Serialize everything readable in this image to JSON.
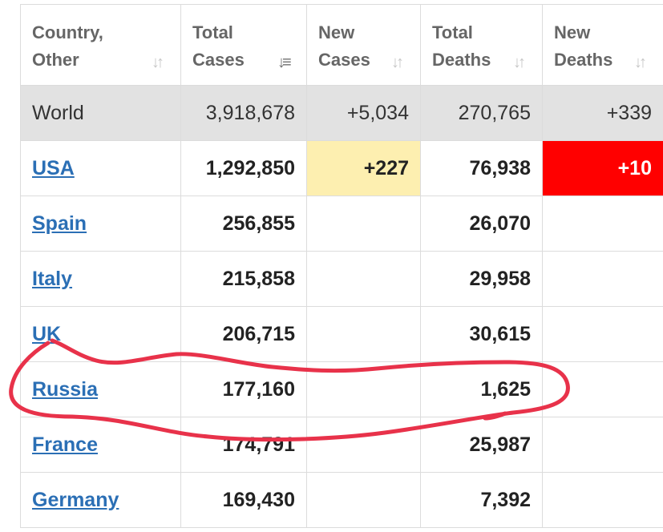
{
  "headers": [
    {
      "line1": "Country,",
      "line2": "Other",
      "icon": "sort-icon"
    },
    {
      "line1": "Total",
      "line2": "Cases",
      "icon": "sort-desc-icon"
    },
    {
      "line1": "New",
      "line2": "Cases",
      "icon": "sort-icon"
    },
    {
      "line1": "Total",
      "line2": "Deaths",
      "icon": "sort-icon"
    },
    {
      "line1": "New",
      "line2": "Deaths",
      "icon": "sort-icon"
    }
  ],
  "rows": [
    {
      "country": "World",
      "total_cases": "3,918,678",
      "new_cases": "+5,034",
      "total_deaths": "270,765",
      "new_deaths": "+339"
    },
    {
      "country": "USA",
      "total_cases": "1,292,850",
      "new_cases": "+227",
      "total_deaths": "76,938",
      "new_deaths": "+10"
    },
    {
      "country": "Spain",
      "total_cases": "256,855",
      "new_cases": "",
      "total_deaths": "26,070",
      "new_deaths": ""
    },
    {
      "country": "Italy",
      "total_cases": "215,858",
      "new_cases": "",
      "total_deaths": "29,958",
      "new_deaths": ""
    },
    {
      "country": "UK",
      "total_cases": "206,715",
      "new_cases": "",
      "total_deaths": "30,615",
      "new_deaths": ""
    },
    {
      "country": "Russia",
      "total_cases": "177,160",
      "new_cases": "",
      "total_deaths": "1,625",
      "new_deaths": ""
    },
    {
      "country": "France",
      "total_cases": "174,791",
      "new_cases": "",
      "total_deaths": "25,987",
      "new_deaths": ""
    },
    {
      "country": "Germany",
      "total_cases": "169,430",
      "new_cases": "",
      "total_deaths": "7,392",
      "new_deaths": ""
    }
  ],
  "colors": {
    "link": "#2b6fb5",
    "new_cases_highlight": "#fdefb0",
    "new_deaths_highlight": "#ff0000",
    "world_row_bg": "#e2e2e2",
    "annotation": "#e8324a"
  }
}
